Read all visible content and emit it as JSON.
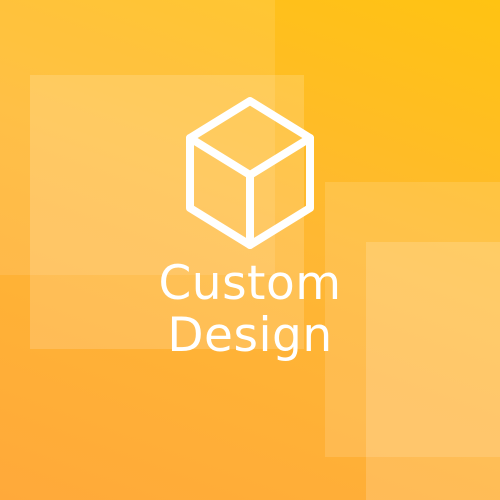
{
  "colors": {
    "background_top": "#FFC312",
    "background_bottom": "#FFA93A",
    "foreground": "#FFFFFF"
  },
  "logo": {
    "icon": "cube-icon",
    "line1": "Custom",
    "line2": "Design"
  }
}
